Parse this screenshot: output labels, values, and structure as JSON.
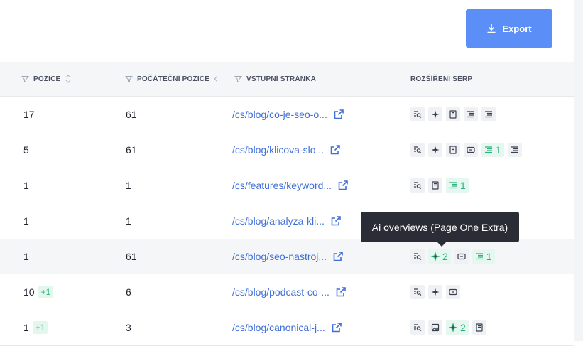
{
  "toolbar": {
    "export_label": "Export"
  },
  "table": {
    "headers": {
      "position": "POZICE",
      "initial_position": "POČÁTEČNÍ POZICE",
      "landing_page": "VSTUPNÍ STRÁNKA",
      "serp_features": "ROZŠÍŘENÍ SERP"
    },
    "rows": [
      {
        "position": "17",
        "change": "",
        "initial": "61",
        "url": "/cs/blog/co-je-seo-o...",
        "features": [
          {
            "icon": "serp-search-icon"
          },
          {
            "icon": "sparkle-icon"
          },
          {
            "icon": "book-icon"
          },
          {
            "icon": "list-icon"
          },
          {
            "icon": "list-icon"
          }
        ]
      },
      {
        "position": "5",
        "change": "",
        "initial": "61",
        "url": "/cs/blog/klicova-slo...",
        "features": [
          {
            "icon": "serp-search-icon"
          },
          {
            "icon": "sparkle-icon"
          },
          {
            "icon": "book-icon"
          },
          {
            "icon": "chat-icon"
          },
          {
            "icon": "list-icon",
            "count": "1"
          },
          {
            "icon": "list-icon"
          }
        ]
      },
      {
        "position": "1",
        "change": "",
        "initial": "1",
        "url": "/cs/features/keyword...",
        "features": [
          {
            "icon": "serp-search-icon"
          },
          {
            "icon": "book-icon"
          },
          {
            "icon": "list-icon",
            "count": "1"
          }
        ]
      },
      {
        "position": "1",
        "change": "",
        "initial": "1",
        "url": "/cs/blog/analyza-kli...",
        "features": []
      },
      {
        "position": "1",
        "change": "",
        "initial": "61",
        "url": "/cs/blog/seo-nastroj...",
        "features": [
          {
            "icon": "serp-search-icon"
          },
          {
            "icon": "sparkle-icon",
            "count": "2"
          },
          {
            "icon": "chat-icon"
          },
          {
            "icon": "list-icon",
            "count": "1"
          }
        ]
      },
      {
        "position": "10",
        "change": "+1",
        "initial": "6",
        "url": "/cs/blog/podcast-co-...",
        "features": [
          {
            "icon": "serp-search-icon"
          },
          {
            "icon": "sparkle-icon"
          },
          {
            "icon": "chat-icon"
          }
        ]
      },
      {
        "position": "1",
        "change": "+1",
        "initial": "3",
        "url": "/cs/blog/canonical-j...",
        "features": [
          {
            "icon": "serp-search-icon"
          },
          {
            "icon": "image-icon"
          },
          {
            "icon": "sparkle-icon",
            "count": "2"
          },
          {
            "icon": "book-icon"
          }
        ]
      }
    ]
  },
  "tooltip": {
    "text": "Ai overviews (Page One Extra)"
  },
  "colors": {
    "accent": "#5b8ef7",
    "link": "#3f6fd8",
    "positive": "#2fb37a",
    "tooltip_bg": "#2a2d35"
  }
}
